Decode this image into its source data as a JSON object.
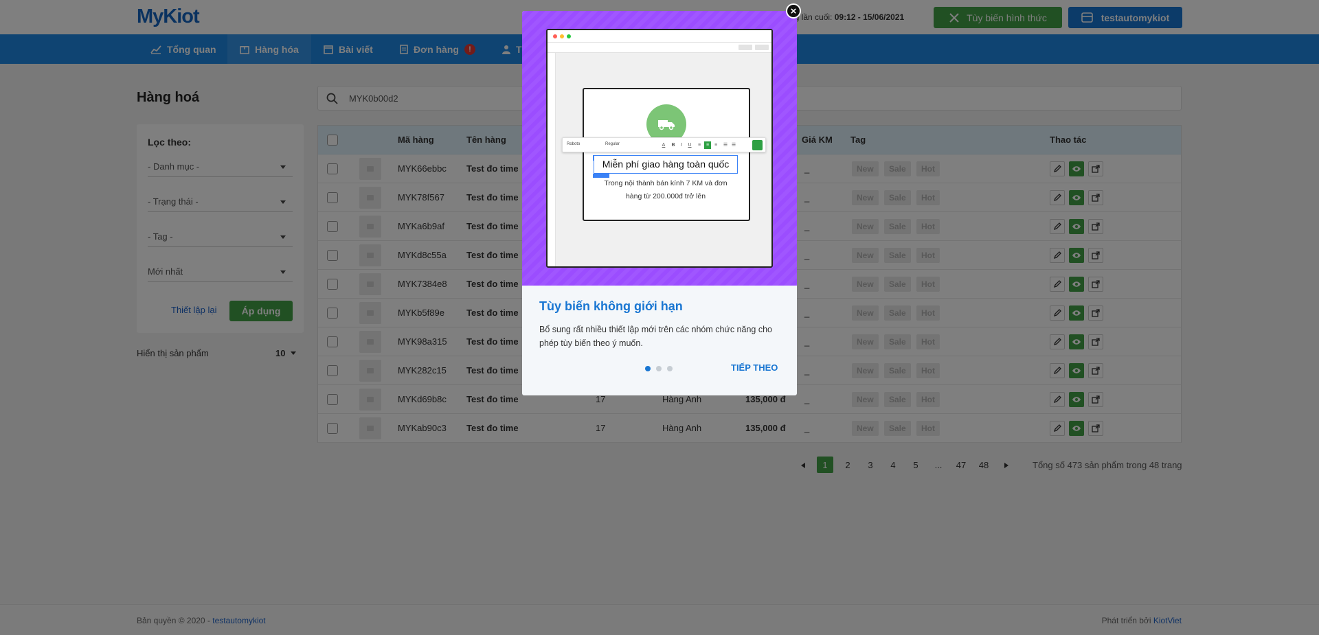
{
  "header": {
    "logo": "MyKiot",
    "last_login_label": "ng lần cuối:",
    "last_login_value": "09:12 - 15/06/2021",
    "customize_button": "Tùy biến hình thức",
    "store_button": "testautomykiot"
  },
  "nav": {
    "items": [
      {
        "label": "Tổng quan"
      },
      {
        "label": "Hàng hóa"
      },
      {
        "label": "Bài viết"
      },
      {
        "label": "Đơn hàng",
        "badge": "!"
      },
      {
        "label": "T"
      }
    ]
  },
  "page": {
    "title": "Hàng hoá",
    "search_value": "MYK0b00d2"
  },
  "filters": {
    "title": "Lọc theo:",
    "category": "- Danh mục -",
    "status": "- Trạng thái -",
    "tag": "- Tag -",
    "sort": "Mới nhất",
    "reset": "Thiết lập lại",
    "apply": "Áp dụng",
    "show_label": "Hiển thị sản phẩm",
    "show_value": "10"
  },
  "table": {
    "columns": {
      "code": "Mã hàng",
      "name": "Tên hàng",
      "sale_price": "Giá KM",
      "tag": "Tag",
      "actions": "Thao tác"
    },
    "tag_labels": [
      "New",
      "Sale",
      "Hot"
    ],
    "rows": [
      {
        "code": "MYK66ebbc",
        "name": "Test đo time",
        "stock": "",
        "brand": "",
        "price": "",
        "sale": "_"
      },
      {
        "code": "MYK78f567",
        "name": "Test đo time",
        "stock": "",
        "brand": "",
        "price": "",
        "sale": "_"
      },
      {
        "code": "MYKa6b9af",
        "name": "Test đo time",
        "stock": "",
        "brand": "",
        "price": "",
        "sale": "_"
      },
      {
        "code": "MYKd8c55a",
        "name": "Test đo time",
        "stock": "",
        "brand": "",
        "price": "",
        "sale": "_"
      },
      {
        "code": "MYK7384e8",
        "name": "Test đo time",
        "stock": "",
        "brand": "",
        "price": "",
        "sale": "_"
      },
      {
        "code": "MYKb5f89e",
        "name": "Test đo time",
        "stock": "",
        "brand": "",
        "price": "",
        "sale": "_"
      },
      {
        "code": "MYK98a315",
        "name": "Test đo time",
        "stock": "",
        "brand": "",
        "price": "",
        "sale": "_"
      },
      {
        "code": "MYK282c15",
        "name": "Test đo time",
        "stock": "",
        "brand": "",
        "price": "",
        "sale": "_"
      },
      {
        "code": "MYKd69b8c",
        "name": "Test đo time",
        "stock": "17",
        "brand": "Hàng Anh",
        "price": "135,000 đ",
        "sale": "_"
      },
      {
        "code": "MYKab90c3",
        "name": "Test đo time",
        "stock": "17",
        "brand": "Hàng Anh",
        "price": "135,000 đ",
        "sale": "_"
      }
    ]
  },
  "pagination": {
    "pages": [
      "1",
      "2",
      "3",
      "4",
      "5",
      "...",
      "47",
      "48"
    ],
    "current": "1",
    "total_text": "Tổng số 473 sản phẩm trong 48 trang"
  },
  "footer": {
    "copyright": "Bản quyền © 2020 - ",
    "copyright_link": "testautomykiot",
    "developed_by": "Phát triển bởi ",
    "developed_link": "KiotViet"
  },
  "modal": {
    "preview_heading": "Miễn phí giao hàng toàn quốc",
    "preview_desc": "Trong nội thành bán kính 7 KM và đơn hàng từ 200.000đ trở lên",
    "preview_font": "Roboto",
    "preview_weight": "Regular",
    "title": "Tùy biến không giới hạn",
    "text": "Bổ sung rất nhiều thiết lập mới trên các nhóm chức năng cho phép tùy biến theo ý muốn.",
    "next": "TIẾP THEO",
    "step_total": 3,
    "step_current": 1
  },
  "colors": {
    "brand_blue": "#1e88e5",
    "green": "#43a047",
    "modal_purple": "#9b4dff"
  }
}
